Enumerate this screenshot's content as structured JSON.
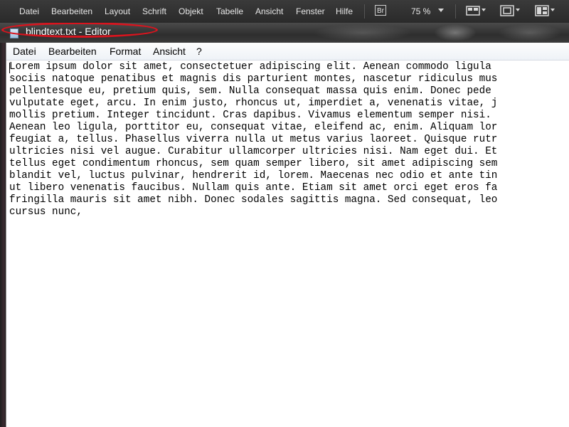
{
  "indesign": {
    "menu": [
      "Datei",
      "Bearbeiten",
      "Layout",
      "Schrift",
      "Objekt",
      "Tabelle",
      "Ansicht",
      "Fenster",
      "Hilfe"
    ],
    "bridge_label": "Br",
    "zoom": "75 %"
  },
  "editor": {
    "title": "blindtext.txt - Editor",
    "menu": [
      "Datei",
      "Bearbeiten",
      "Format",
      "Ansicht",
      "?"
    ],
    "text": "Lorem ipsum dolor sit amet, consectetuer adipiscing elit. Aenean commodo ligula\nsociis natoque penatibus et magnis dis parturient montes, nascetur ridiculus mus\npellentesque eu, pretium quis, sem. Nulla consequat massa quis enim. Donec pede\nvulputate eget, arcu. In enim justo, rhoncus ut, imperdiet a, venenatis vitae, j\nmollis pretium. Integer tincidunt. Cras dapibus. Vivamus elementum semper nisi.\nAenean leo ligula, porttitor eu, consequat vitae, eleifend ac, enim. Aliquam lor\nfeugiat a, tellus. Phasellus viverra nulla ut metus varius laoreet. Quisque rutr\nultricies nisi vel augue. Curabitur ullamcorper ultricies nisi. Nam eget dui. Et\ntellus eget condimentum rhoncus, sem quam semper libero, sit amet adipiscing sem\nblandit vel, luctus pulvinar, hendrerit id, lorem. Maecenas nec odio et ante tin\nut libero venenatis faucibus. Nullam quis ante. Etiam sit amet orci eget eros fa\nfringilla mauris sit amet nibh. Donec sodales sagittis magna. Sed consequat, leo\ncursus nunc,"
  },
  "colors": {
    "highlight_ellipse": "#d9141e"
  }
}
